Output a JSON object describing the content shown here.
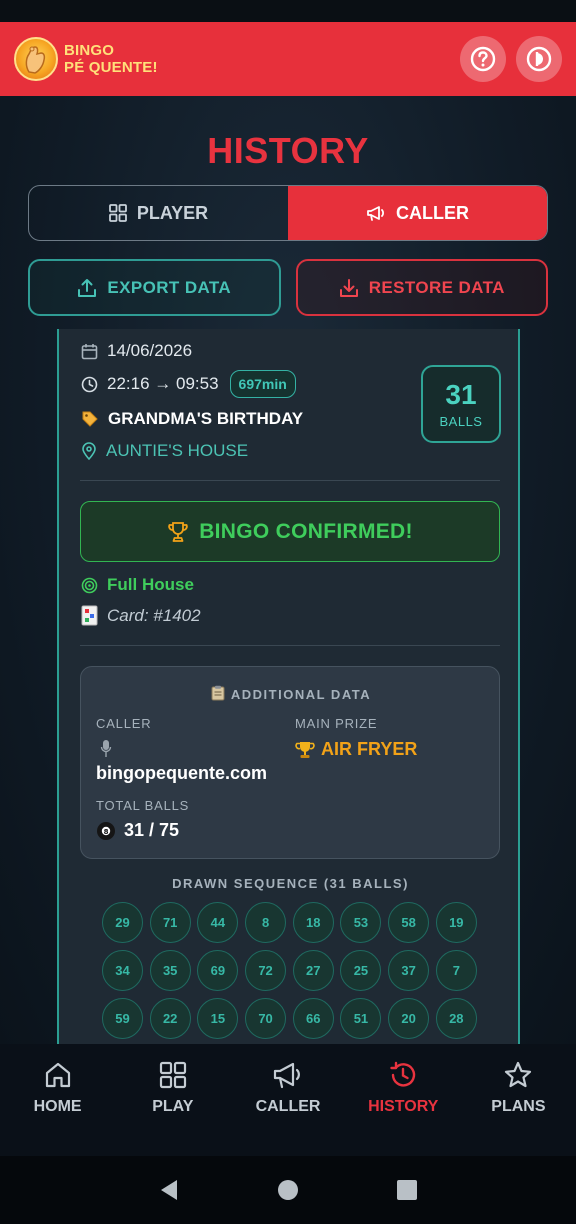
{
  "app": {
    "logo_line1": "BINGO",
    "logo_line2": "PÉ QUENTE!",
    "help_icon": "question-circle-icon",
    "power_icon": "power-icon"
  },
  "page": {
    "title": "HISTORY"
  },
  "mode_toggle": {
    "player_label": "PLAYER",
    "caller_label": "CALLER",
    "active": "CALLER"
  },
  "actions": {
    "export_label": "EXPORT DATA",
    "restore_label": "RESTORE DATA"
  },
  "game": {
    "date": "14/06/2026",
    "time_range": "22:16 → 09:53",
    "duration": "697min",
    "event_name": "GRANDMA'S BIRTHDAY",
    "location": "AUNTIE'S HOUSE",
    "balls_count": "31",
    "balls_label": "BALLS",
    "bingo_status": "BINGO CONFIRMED!",
    "pattern": "Full House",
    "card": "Card: #1402"
  },
  "additional": {
    "title": "ADDITIONAL DATA",
    "caller_label": "CALLER",
    "caller_value": "bingopequente.com",
    "prize_label": "MAIN PRIZE",
    "prize_value": "AIR FRYER",
    "total_label": "TOTAL BALLS",
    "total_value": "31 / 75"
  },
  "sequence": {
    "title": "DRAWN SEQUENCE (31 BALLS)",
    "balls": [
      "29",
      "71",
      "44",
      "8",
      "18",
      "53",
      "58",
      "19",
      "34",
      "35",
      "69",
      "72",
      "27",
      "25",
      "37",
      "7",
      "59",
      "22",
      "15",
      "70",
      "66",
      "51",
      "20",
      "28"
    ]
  },
  "nav": {
    "items": [
      {
        "label": "HOME",
        "icon": "home-icon"
      },
      {
        "label": "PLAY",
        "icon": "grid-icon"
      },
      {
        "label": "CALLER",
        "icon": "megaphone-icon"
      },
      {
        "label": "HISTORY",
        "icon": "history-icon"
      },
      {
        "label": "PLANS",
        "icon": "star-icon"
      }
    ],
    "active": "HISTORY"
  },
  "colors": {
    "brand_red": "#e7303b",
    "teal": "#2b9f93",
    "green": "#3fcd5c",
    "gold": "#f2a218"
  }
}
